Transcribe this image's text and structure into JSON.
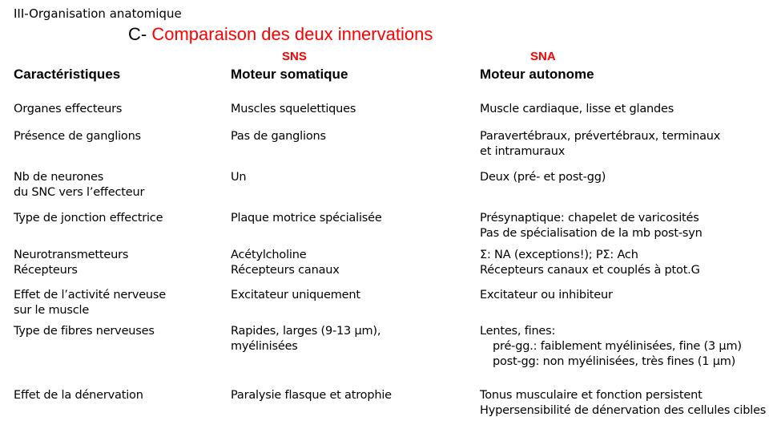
{
  "section": "III-Organisation anatomique",
  "title": {
    "prefix": "C-",
    "main": "Comparaison des deux innervations"
  },
  "columns": {
    "sns_tag": "SNS",
    "sna_tag": "SNA",
    "h1": "Caractéristiques",
    "h2": "Moteur somatique",
    "h3": "Moteur autonome"
  },
  "rows": [
    {
      "c1": [
        "Organes effecteurs"
      ],
      "c2": [
        "Muscles squelettiques"
      ],
      "c3": [
        "Muscle cardiaque, lisse et glandes"
      ]
    },
    {
      "c1": [
        "Présence de ganglions"
      ],
      "c2": [
        "Pas de ganglions"
      ],
      "c3": [
        "Paravertébraux, prévertébraux, terminaux",
        "et intramuraux"
      ]
    },
    {
      "c1": [
        "Nb de neurones",
        "du SNC vers l’effecteur"
      ],
      "c2": [
        "Un"
      ],
      "c3": [
        "Deux (pré- et post-gg)"
      ]
    },
    {
      "c1": [
        "Type de jonction effectrice"
      ],
      "c2": [
        "Plaque motrice spécialisée"
      ],
      "c3": [
        "Présynaptique: chapelet de varicosités",
        "Pas de spécialisation de la mb post-syn"
      ]
    },
    {
      "c1": [
        "Neurotransmetteurs",
        "Récepteurs"
      ],
      "c2": [
        "Acétylcholine",
        "Récepteurs canaux"
      ],
      "c3": [
        "Σ: NA (exceptions!);  PΣ: Ach",
        "Récepteurs canaux et couplés à ptot.G"
      ]
    },
    {
      "c1": [
        "Effet de l’activité nerveuse",
        "sur le muscle"
      ],
      "c2": [
        "Excitateur uniquement"
      ],
      "c3": [
        "Excitateur ou inhibiteur"
      ]
    },
    {
      "c1": [
        "Type de fibres nerveuses"
      ],
      "c2": [
        "Rapides, larges (9-13 µm),",
        "myélinisées"
      ],
      "c3": [
        "Lentes, fines:",
        "pré-gg.: faiblement myélinisées, fine (3 µm)",
        "post-gg: non myélinisées, très fines (1 µm)"
      ]
    },
    {
      "c1": [
        "Effet de la dénervation"
      ],
      "c2": [
        "Paralysie flasque et atrophie"
      ],
      "c3": [
        "Tonus musculaire et fonction persistent",
        "Hypersensibilité de dénervation des cellules cibles"
      ]
    }
  ]
}
